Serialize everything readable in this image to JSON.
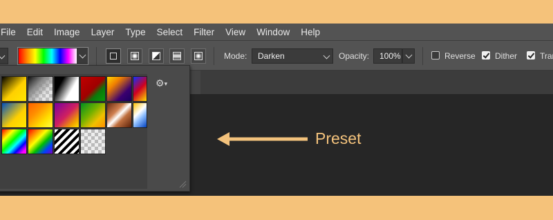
{
  "menu": [
    "File",
    "Edit",
    "Image",
    "Layer",
    "Type",
    "Select",
    "Filter",
    "View",
    "Window",
    "Help"
  ],
  "options": {
    "mode_label": "Mode:",
    "mode_value": "Darken",
    "opacity_label": "Opacity:",
    "opacity_value": "100%",
    "reverse_label": "Reverse",
    "reverse_checked": false,
    "dither_label": "Dither",
    "dither_checked": true,
    "transparency_label": "Tran",
    "transparency_checked": true
  },
  "annotation": {
    "text": "Preset",
    "color": "#f3c27c"
  },
  "colors": {
    "background": "#f5c27a",
    "menubar": "#535353",
    "workspace": "#262626"
  },
  "icons": [
    "gear-icon",
    "resize-grip-icon",
    "chevron-down-icon",
    "linear-gradient-icon",
    "radial-gradient-icon",
    "angle-gradient-icon",
    "reflected-gradient-icon",
    "diamond-gradient-icon"
  ]
}
